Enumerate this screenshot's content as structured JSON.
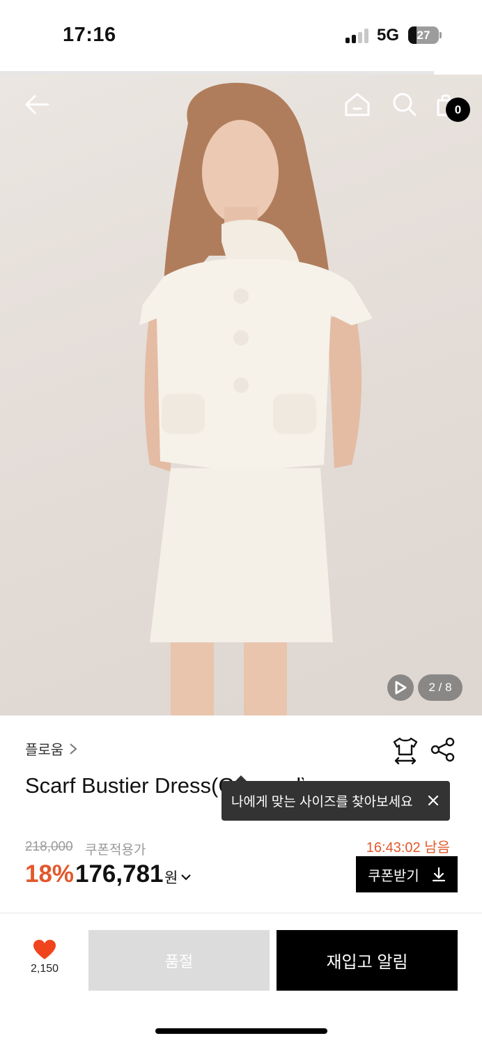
{
  "status_bar": {
    "time": "17:16",
    "network": "5G",
    "battery": "27"
  },
  "header": {
    "cart_count": "0",
    "icons": [
      "back-arrow-icon",
      "home-icon",
      "search-icon",
      "shopping-bag-icon"
    ]
  },
  "gallery": {
    "page_indicator": "2 / 8"
  },
  "product": {
    "brand": "플로움",
    "title": "Scarf Bustier Dress(Cropped)",
    "size_tooltip": "나에게 맞는 사이즈를 찾아보세요",
    "original_price": "218,000",
    "coupon_label": "쿠폰적용가",
    "discount_rate": "18%",
    "sale_price": "176,781",
    "currency": "원",
    "timer": "16:43:02 남음",
    "coupon_button": "쿠폰받기"
  },
  "actions": {
    "like_count": "2,150",
    "soldout_label": "품절",
    "restock_label": "재입고 알림"
  },
  "colors": {
    "accent": "#e2582b",
    "primary": "#000000",
    "disabled": "#dcdcdc"
  }
}
